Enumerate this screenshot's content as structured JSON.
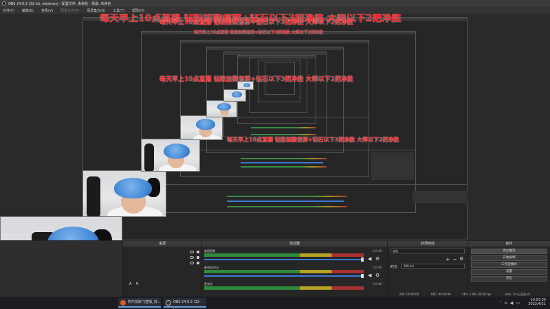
{
  "window": {
    "title": "OBS 24.0.3 (32-bit, windows) - 配置文件: 未命名 - 场景: 未命名"
  },
  "menu": {
    "items": [
      "文件(F)",
      "编辑(E)",
      "查看(V)",
      "配置文件(P)",
      "场景集合(S)",
      "工具(T)",
      "帮助(H)"
    ]
  },
  "overlay": {
    "text": "每天早上10点直播 钻粉加微信群+钻石以下3把净胜 大师以下2把净胜"
  },
  "docks": {
    "sources": {
      "title": "来源",
      "add_label": "+",
      "remove_label": "−",
      "up_label": "∧",
      "down_label": "∨"
    },
    "mixer": {
      "title": "混音器",
      "channels": [
        {
          "label": "桌面音频",
          "db": "0.0 dB"
        },
        {
          "label": "麦克风/Aux",
          "db": "0.0 dB"
        },
        {
          "label": "麦克风",
          "db": "0.0 dB"
        }
      ]
    },
    "transitions": {
      "title": "转场特效",
      "current": "淡出",
      "duration_label": "时长",
      "duration_value": "300 ms"
    },
    "controls": {
      "title": "控件",
      "buttons": [
        "停止推流",
        "开始录制",
        "工作室模式",
        "设置",
        "退出"
      ]
    }
  },
  "statusbar": {
    "live": "LIVE: 00:00:00",
    "rec": "REC: 00:00:00",
    "cpu": "CPU: 1.9%, 60.00 fps",
    "kbps": "kb/s: 10 (已丢失 0)"
  },
  "taskbar": {
    "items": [
      {
        "label": "阿尔张斯飞直播_浏...",
        "icon_color": "#e05a2b"
      },
      {
        "label": "OBS 24.0.3 (32-bit...",
        "icon_color": "#333333"
      }
    ],
    "time": "10:03:30",
    "date": "2022/4/21"
  }
}
